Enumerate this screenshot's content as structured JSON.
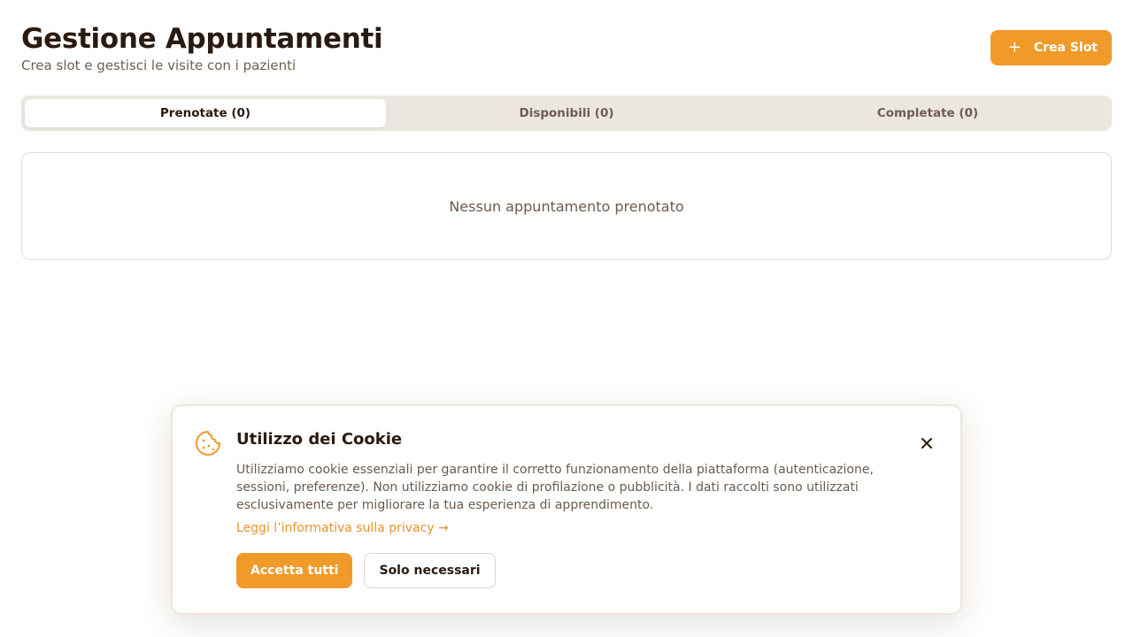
{
  "header": {
    "title": "Gestione Appuntamenti",
    "subtitle": "Crea slot e gestisci le visite con i pazienti",
    "create_button": {
      "icon": "plus-icon",
      "label": "Crea Slot"
    }
  },
  "tabs": [
    {
      "label": "Prenotate (0)",
      "active": true
    },
    {
      "label": "Disponibili (0)",
      "active": false
    },
    {
      "label": "Completate (0)",
      "active": false
    }
  ],
  "empty_state": {
    "text": "Nessun appuntamento prenotato"
  },
  "cookie_banner": {
    "icon": "cookie-icon",
    "title": "Utilizzo dei Cookie",
    "text": "Utilizziamo cookie essenziali per garantire il corretto funzionamento della piattaforma (autenticazione, sessioni, preferenze). Non utilizziamo cookie di profilazione o pubblicità. I dati raccolti sono utilizzati esclusivamente per migliorare la tua esperienza di apprendimento.",
    "privacy_link": "Leggi l’informativa sulla privacy →",
    "accept_all": "Accetta tutti",
    "necessary_only": "Solo necessari",
    "close_icon": "close-icon"
  },
  "colors": {
    "accent": "#f09a2a",
    "text_dark": "#2a1a10",
    "text_muted": "#6f5f52",
    "tab_bg": "#ebe6e0"
  }
}
